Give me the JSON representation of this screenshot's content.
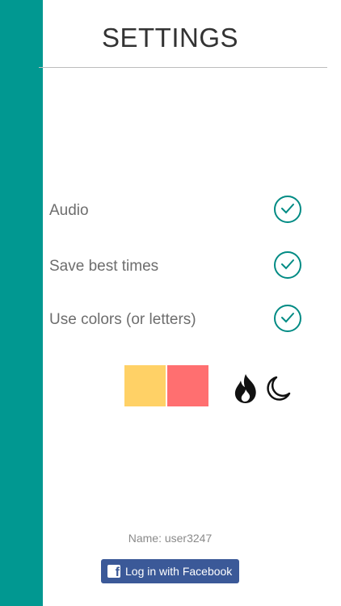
{
  "header": {
    "title": "SETTINGS"
  },
  "settings": [
    {
      "label": "Audio",
      "enabled": true
    },
    {
      "label": "Save best times",
      "enabled": true
    },
    {
      "label": "Use colors (or letters)",
      "enabled": true
    }
  ],
  "swatches": [
    {
      "name": "yellow",
      "color": "#ffd166"
    },
    {
      "name": "red",
      "color": "#ff6f70"
    }
  ],
  "theme_icons": [
    "flame-icon",
    "moon-icon"
  ],
  "account": {
    "name_text": "Name: user3247",
    "facebook_label": "Log in with Facebook",
    "facebook_icon": "facebook-icon"
  },
  "colors": {
    "accent": "#019891",
    "facebook": "#3b5998"
  }
}
